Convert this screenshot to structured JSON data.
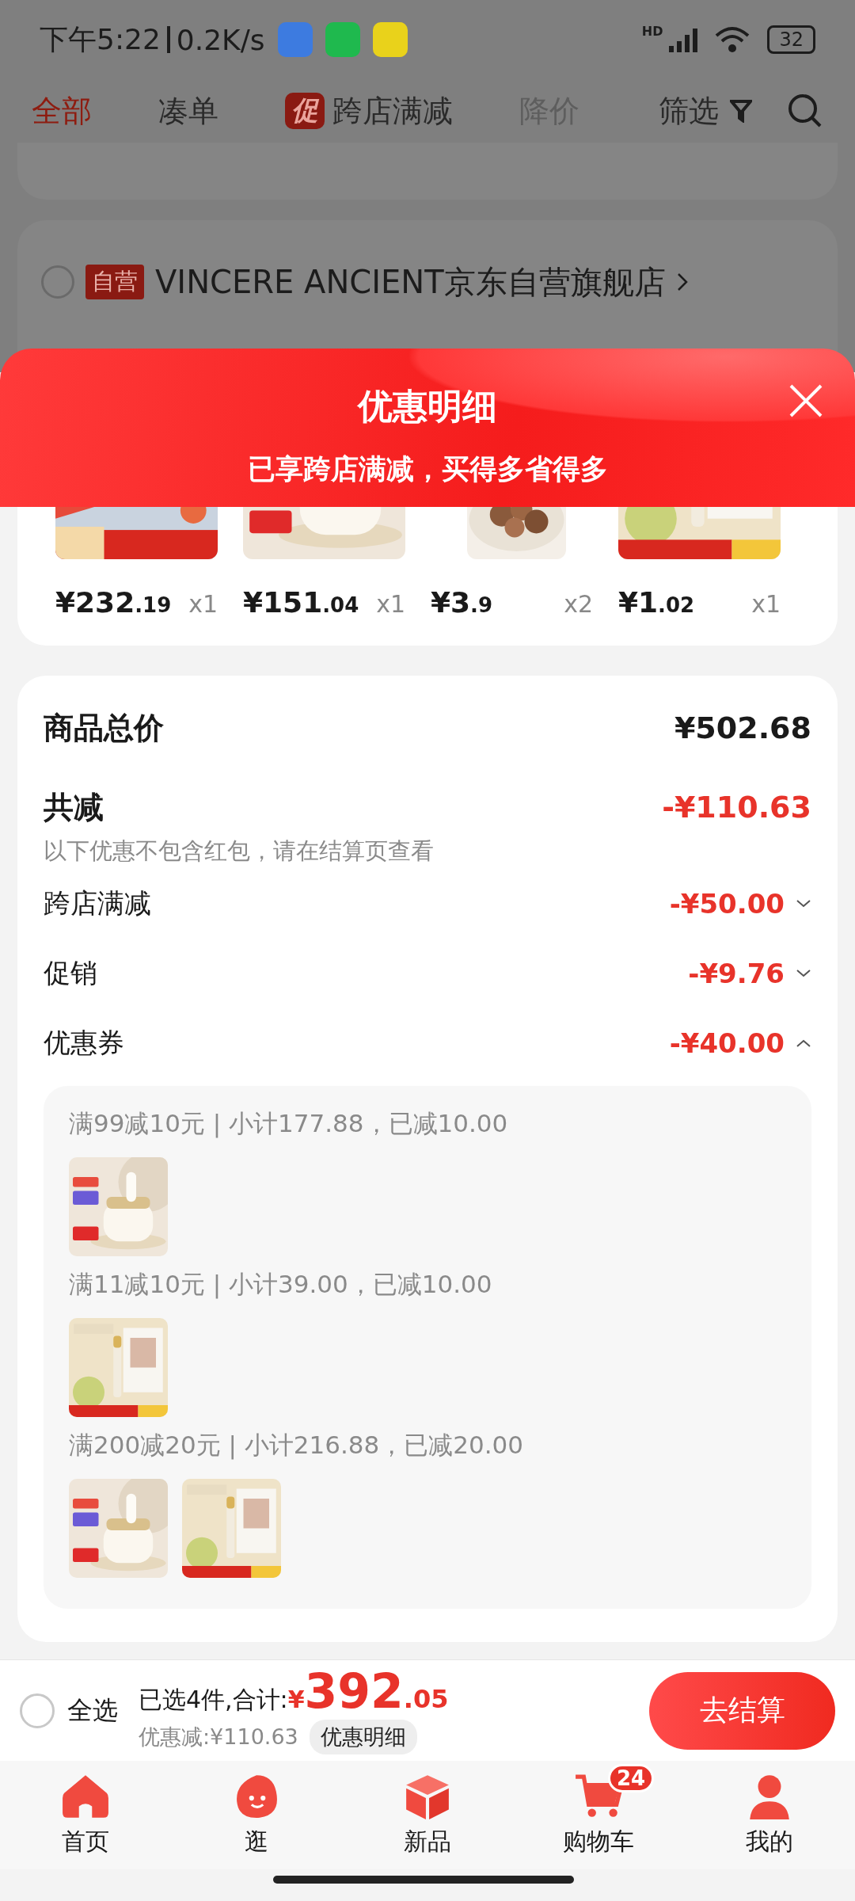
{
  "status_bar": {
    "time": "下午5:22",
    "speed": "0.2K/s",
    "network_badge": "HD",
    "battery": "32"
  },
  "filter_tabs": [
    {
      "label": "全部",
      "selected": true,
      "disabled": false
    },
    {
      "label": "凑单",
      "selected": false,
      "disabled": false
    },
    {
      "label": "跨店满减",
      "badge": "促",
      "selected": false,
      "disabled": false
    },
    {
      "label": "降价",
      "selected": false,
      "disabled": true
    }
  ],
  "filter_button": "筛选",
  "stores": [
    {
      "tag": "自营",
      "name": "VINCERE ANCIENT京东自营旗舰店",
      "checked": false
    }
  ],
  "sheet": {
    "title": "优惠明细",
    "subtitle": "已享跨店满减，买得多省得多",
    "products": [
      {
        "kind": "picture",
        "price_int": "¥232",
        "price_dec": ".19",
        "qty": "x1"
      },
      {
        "kind": "picture",
        "price_int": "¥151",
        "price_dec": ".04",
        "qty": "x1"
      },
      {
        "kind": "picture",
        "price_int": "¥3",
        "price_dec": ".9",
        "qty": "x2"
      },
      {
        "kind": "picture",
        "price_int": "¥1",
        "price_dec": ".02",
        "qty": "x1"
      }
    ],
    "total_label": "商品总价",
    "total": "¥502.68",
    "discount_label": "共减",
    "discount": "-¥110.63",
    "note": "以下优惠不包含红包，请在结算页查看",
    "items": [
      {
        "label": "跨店满减",
        "amount": "-¥50.00",
        "expanded": false
      },
      {
        "label": "促销",
        "amount": "-¥9.76",
        "expanded": false
      },
      {
        "label": "优惠券",
        "amount": "-¥40.00",
        "expanded": true
      }
    ],
    "coupons": [
      {
        "text": "满99减10元 | 小计177.88，已减10.00"
      },
      {
        "text": "满11减10元 | 小计39.00，已减10.00"
      },
      {
        "text": "满200减20元 | 小计216.88，已减20.00"
      }
    ]
  },
  "bottom_bar": {
    "select_all": {
      "label": "全选",
      "checked": false
    },
    "summary": "已选4件,合计:",
    "currency": "¥",
    "amount_int": "392",
    "amount_dec": ".05",
    "saved": "优惠减:¥110.63",
    "detail_button": "优惠明细",
    "checkout": "去结算"
  },
  "nav": [
    {
      "kind": "home",
      "label": "首页"
    },
    {
      "kind": "stroll",
      "label": "逛"
    },
    {
      "kind": "new",
      "label": "新品"
    },
    {
      "kind": "cart",
      "label": "购物车",
      "badge": "24"
    },
    {
      "kind": "me",
      "label": "我的"
    }
  ]
}
